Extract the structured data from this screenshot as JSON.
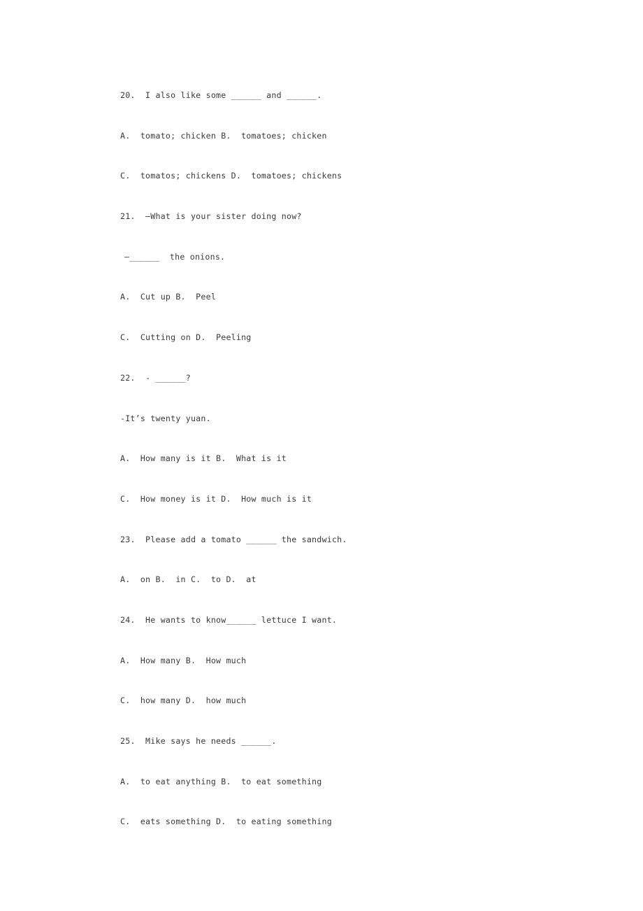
{
  "document": {
    "type": "english-grammar-worksheet",
    "background_color": "#ffffff",
    "text_color": "#3a3a3a",
    "questions": [
      {
        "number": "20.",
        "lines": [
          "20.  I also like some ______ and ______.",
          "A.  tomato; chicken B.  tomatoes; chicken",
          "C.  tomatos; chickens D.  tomatoes; chickens"
        ]
      },
      {
        "number": "21.",
        "lines": [
          "21.  —What is your sister doing now?",
          "—______  the onions.",
          "A.  Cut up B.  Peel",
          "C.  Cutting on D.  Peeling"
        ]
      },
      {
        "number": "22.",
        "lines": [
          "22.  - ______?",
          "-It’s twenty yuan.",
          "A.  How many is it B.  What is it",
          "C.  How money is it D.  How much is it"
        ]
      },
      {
        "number": "23.",
        "lines": [
          "23.  Please add a tomato ______ the sandwich.",
          "A.  on B.  in C.  to D.  at"
        ]
      },
      {
        "number": "24.",
        "lines": [
          "24.  He wants to know______ lettuce I want.",
          "A.  How many B.  How much",
          "C.  how many D.  how much"
        ]
      },
      {
        "number": "25.",
        "lines": [
          "25.  Mike says he needs ______.",
          "A.  to eat anything B.  to eat something",
          "C.  eats something D.  to eating something"
        ]
      }
    ],
    "body_lines": [
      {
        "id": "q20-stem",
        "text": "20.  I also like some ______ and ______.",
        "indent": false
      },
      {
        "id": "q20-opt-ab",
        "text": "A.  tomato; chicken B.  tomatoes; chicken",
        "indent": false
      },
      {
        "id": "q20-opt-cd",
        "text": "C.  tomatos; chickens D.  tomatoes; chickens",
        "indent": false
      },
      {
        "id": "q21-stem",
        "text": "21.  —What is your sister doing now?",
        "indent": false
      },
      {
        "id": "q21-reply",
        "text": "—______  the onions.",
        "indent": true
      },
      {
        "id": "q21-opt-ab",
        "text": "A.  Cut up B.  Peel",
        "indent": false
      },
      {
        "id": "q21-opt-cd",
        "text": "C.  Cutting on D.  Peeling",
        "indent": false
      },
      {
        "id": "q22-stem",
        "text": "22.  - ______?",
        "indent": false
      },
      {
        "id": "q22-reply",
        "text": "-It’s twenty yuan.",
        "indent": false
      },
      {
        "id": "q22-opt-ab",
        "text": "A.  How many is it B.  What is it",
        "indent": false
      },
      {
        "id": "q22-opt-cd",
        "text": "C.  How money is it D.  How much is it",
        "indent": false
      },
      {
        "id": "q23-stem",
        "text": "23.  Please add a tomato ______ the sandwich.",
        "indent": false
      },
      {
        "id": "q23-opt",
        "text": "A.  on B.  in C.  to D.  at",
        "indent": false
      },
      {
        "id": "q24-stem",
        "text": "24.  He wants to know______ lettuce I want.",
        "indent": false
      },
      {
        "id": "q24-opt-ab",
        "text": "A.  How many B.  How much",
        "indent": false
      },
      {
        "id": "q24-opt-cd",
        "text": "C.  how many D.  how much",
        "indent": false
      },
      {
        "id": "q25-stem",
        "text": "25.  Mike says he needs ______.",
        "indent": false
      },
      {
        "id": "q25-opt-ab",
        "text": "A.  to eat anything B.  to eat something",
        "indent": false
      },
      {
        "id": "q25-opt-cd",
        "text": "C.  eats something D.  to eating something",
        "indent": false
      }
    ]
  }
}
